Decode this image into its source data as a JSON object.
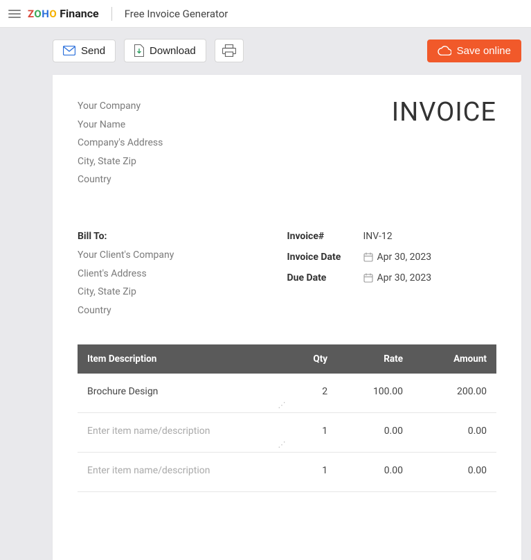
{
  "header": {
    "brand_finance": "Finance",
    "subtitle": "Free Invoice Generator"
  },
  "toolbar": {
    "send": "Send",
    "download": "Download",
    "save": "Save online"
  },
  "company": {
    "l1": "Your Company",
    "l2": "Your Name",
    "l3": "Company's Address",
    "l4": "City, State Zip",
    "l5": "Country"
  },
  "invoice_title": "INVOICE",
  "bill": {
    "label": "Bill To:",
    "l1": "Your Client's Company",
    "l2": "Client's Address",
    "l3": "City, State Zip",
    "l4": "Country"
  },
  "meta": {
    "number_label": "Invoice#",
    "number_value": "INV-12",
    "date_label": "Invoice Date",
    "date_value": "Apr 30, 2023",
    "due_label": "Due Date",
    "due_value": "Apr 30, 2023"
  },
  "table": {
    "headers": {
      "desc": "Item Description",
      "qty": "Qty",
      "rate": "Rate",
      "amount": "Amount"
    },
    "placeholder": "Enter item name/description",
    "rows": [
      {
        "desc": "Brochure Design",
        "qty": "2",
        "rate": "100.00",
        "amount": "200.00",
        "is_placeholder": false
      },
      {
        "desc": "Enter item name/description",
        "qty": "1",
        "rate": "0.00",
        "amount": "0.00",
        "is_placeholder": true
      },
      {
        "desc": "Enter item name/description",
        "qty": "1",
        "rate": "0.00",
        "amount": "0.00",
        "is_placeholder": true
      }
    ]
  }
}
